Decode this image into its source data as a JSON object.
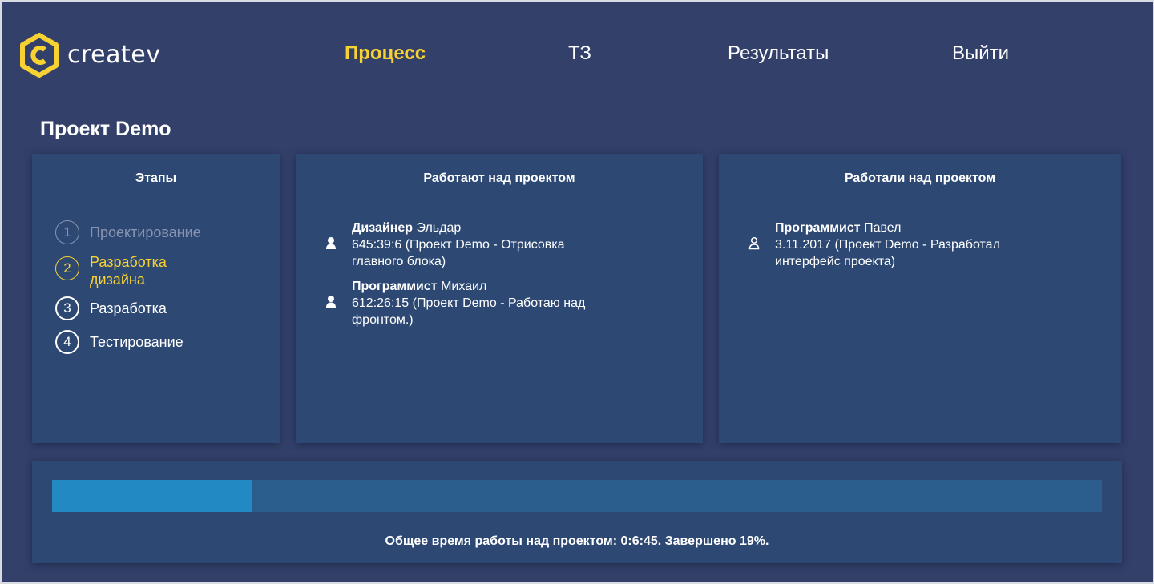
{
  "header": {
    "logo_text": "createv",
    "nav": [
      {
        "label": "Процесс",
        "active": true
      },
      {
        "label": "ТЗ",
        "active": false
      },
      {
        "label": "Результаты",
        "active": false
      },
      {
        "label": "Выйти",
        "active": false
      }
    ]
  },
  "project": {
    "title": "Проект Demo"
  },
  "stages_card": {
    "title": "Этапы",
    "items": [
      {
        "number": "1",
        "label": "Проектирование",
        "state": "done"
      },
      {
        "number": "2",
        "label": "Разработка дизайна",
        "state": "current"
      },
      {
        "number": "3",
        "label": "Разработка",
        "state": "pending"
      },
      {
        "number": "4",
        "label": "Тестирование",
        "state": "pending"
      }
    ]
  },
  "working_card": {
    "title": "Работают над проектом",
    "items": [
      {
        "role": "Дизайнер",
        "name": " Эльдар",
        "details": "645:39:6 (Проект Demo - Отрисовка главного блока)",
        "icon": "user-solid-icon"
      },
      {
        "role": "Программист",
        "name": " Михаил",
        "details": "612:26:15 (Проект Demo - Работаю над фронтом.)",
        "icon": "user-solid-icon"
      }
    ]
  },
  "worked_card": {
    "title": "Работали над проектом",
    "items": [
      {
        "role": "Программист",
        "name": " Павел",
        "details": "3.11.2017 (Проект Demo - Разработал интерфейс проекта)",
        "icon": "user-outline-icon"
      }
    ]
  },
  "progress": {
    "percent": 19,
    "caption": "Общее время работы над проектом: 0:6:45. Завершено 19%."
  },
  "colors": {
    "background": "#33406a",
    "card": "#2d4873",
    "accent": "#f7d232",
    "progress_track": "#2b5e8c",
    "progress_fill": "#2389c3"
  }
}
